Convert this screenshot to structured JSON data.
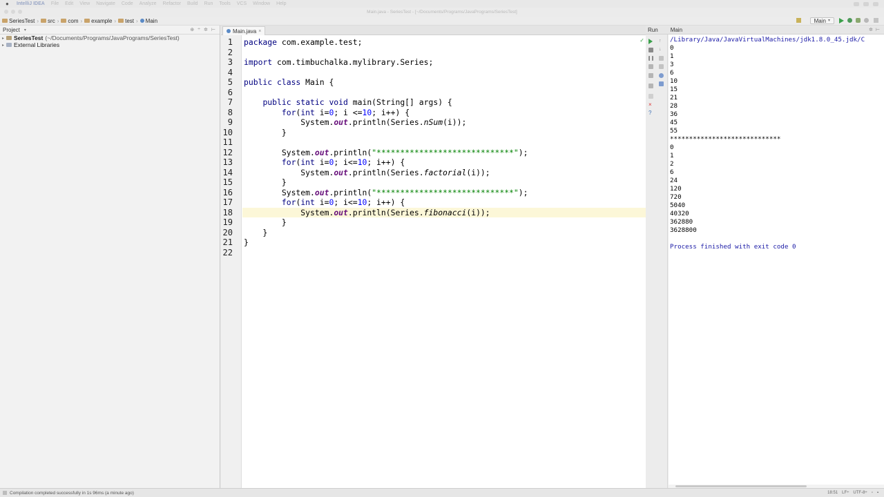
{
  "menubar": {
    "app": "IntelliJ IDEA",
    "items": [
      "File",
      "Edit",
      "View",
      "Navigate",
      "Code",
      "Analyze",
      "Refactor",
      "Build",
      "Run",
      "Tools",
      "VCS",
      "Window",
      "Help"
    ]
  },
  "window": {
    "title": "Main.java - SeriesTest - [~/Documents/Programs/JavaPrograms/SeriesTest]"
  },
  "breadcrumbs": [
    "SeriesTest",
    "src",
    "com",
    "example",
    "test",
    "Main"
  ],
  "run_config": "Main",
  "project": {
    "header": "Project",
    "tree": [
      {
        "name": "SeriesTest",
        "path": "(~/Documents/Programs/JavaPrograms/SeriesTest)"
      },
      {
        "name": "External Libraries",
        "path": ""
      }
    ]
  },
  "editor": {
    "tab": "Main.java",
    "current_line": 18,
    "line_numbers": [
      "1",
      "2",
      "3",
      "4",
      "5",
      "6",
      "7",
      "8",
      "9",
      "10",
      "11",
      "12",
      "13",
      "14",
      "15",
      "16",
      "17",
      "18",
      "19",
      "20",
      "21",
      "22"
    ]
  },
  "run": {
    "header": "Run",
    "config": "Main",
    "console": {
      "path": "/Library/Java/JavaVirtualMachines/jdk1.8.0_45.jdk/C",
      "nsum": [
        "0",
        "1",
        "3",
        "6",
        "10",
        "15",
        "21",
        "28",
        "36",
        "45",
        "55"
      ],
      "separator": "*****************************",
      "factorial": [
        "0",
        "1",
        "2",
        "6",
        "24",
        "120",
        "720",
        "5040",
        "40320",
        "362880",
        "3628800"
      ],
      "finished": "Process finished with exit code 0"
    }
  },
  "statusbar": {
    "message": "Compilation completed successfully in 1s 96ms (a minute ago)",
    "position": "18:51",
    "line_sep": "LF÷",
    "encoding": "UTF-8÷"
  },
  "colors": {
    "keyword": "#000080",
    "string": "#008000",
    "number": "#0000ff",
    "field": "#660e7a",
    "current_line": "#fcf7d8",
    "console_meta": "#1a1aa6"
  }
}
